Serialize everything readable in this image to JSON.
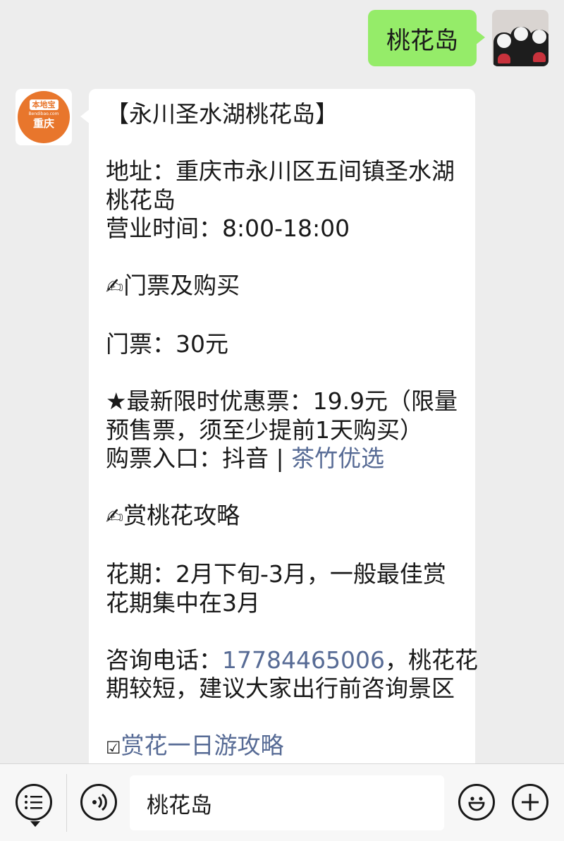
{
  "outgoing": {
    "text": "桃花岛"
  },
  "incoming": {
    "avatar": {
      "brand": "本地宝",
      "domain": "Bendibao.com",
      "city": "重庆"
    },
    "lines": {
      "title": "【永川圣水湖桃花岛】",
      "address_1": "地址：重庆市永川区五间镇圣水湖",
      "address_2": "桃花岛",
      "hours": "营业时间：8:00-18:00",
      "section_tickets_emoji": "✍",
      "section_tickets": "门票及购买",
      "ticket_price": "门票：30元",
      "promo_1": "★最新限时优惠票：19.9元（限量",
      "promo_2": "预售票，须至少提前1天购买）",
      "purchase_prefix": "购票入口：抖音 | ",
      "purchase_link": "茶竹优选",
      "section_guide_emoji": "✍",
      "section_guide": "赏桃花攻略",
      "bloom_1": "花期：2月下旬-3月，一般最佳赏",
      "bloom_2": "花期集中在3月",
      "phone_prefix": "咨询电话：",
      "phone_number": "17784465006",
      "phone_suffix": "，桃花花",
      "advice": "期较短，建议大家出行前咨询景区",
      "trip_checkbox": "☑",
      "trip_link": "赏花一日游攻略"
    }
  },
  "input_bar": {
    "text_value": "桃花岛",
    "icons": {
      "menu": "menu-list-icon",
      "voice": "voice-icon",
      "emoji": "emoji-icon",
      "plus": "plus-icon"
    }
  },
  "colors": {
    "background": "#ededed",
    "outgoing_bubble": "#95ec69",
    "incoming_bubble": "#ffffff",
    "link": "#576b95",
    "logo_orange": "#e8762c"
  }
}
